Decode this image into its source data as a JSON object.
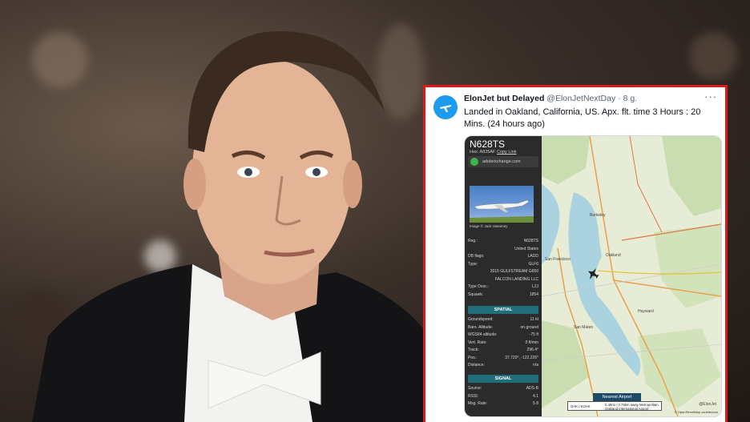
{
  "tweet": {
    "name": "ElonJet but Delayed",
    "handle": "@ElonJetNextDay",
    "dot": "·",
    "time": "8 g.",
    "more": "···",
    "text": "Landed in Oakland, California, US. Apx. flt. time 3 Hours : 20 Mins. (24 hours ago)"
  },
  "panel": {
    "registration": "N628TS",
    "hex_label": "Hex:",
    "hex_value": "A835AF",
    "copy_link": "Copy Link",
    "source_site": "adsbexchange.com",
    "photo_credit": "Image © Jack Sweeney",
    "details": [
      {
        "k": "Reg.:",
        "v": "N628TS"
      },
      {
        "k": "",
        "v": "United States"
      },
      {
        "k": "DB flags:",
        "v": "LADD"
      },
      {
        "k": "Type:",
        "v": "GLF6"
      },
      {
        "k": "",
        "v": "2015 GULFSTREAM G650"
      },
      {
        "k": "",
        "v": "FALCON LANDING LLC"
      },
      {
        "k": "Type Desc.:",
        "v": "L2J"
      },
      {
        "k": "Squawk:",
        "v": "1854"
      }
    ],
    "spatial_label": "SPATIAL",
    "spatial": [
      {
        "k": "Groundspeed:",
        "v": "11 kt"
      },
      {
        "k": "Baro. Altitude:",
        "v": "on ground"
      },
      {
        "k": "WGS84 altitude:",
        "v": "-75 ft"
      },
      {
        "k": "Vert. Rate:",
        "v": "0 ft/min"
      },
      {
        "k": "Track:",
        "v": "296.4°"
      },
      {
        "k": "Pos.:",
        "v": "37.720°, -122.226°"
      },
      {
        "k": "Distance:",
        "v": "n/a"
      }
    ],
    "signal_label": "SIGNAL",
    "signal": [
      {
        "k": "Source:",
        "v": "ADS-B"
      },
      {
        "k": "RSSI:",
        "v": "4.1"
      },
      {
        "k": "Msg. Rate:",
        "v": "5.8"
      }
    ]
  },
  "map": {
    "nearest_label": "Nearest Airport",
    "airport_code": "OAK / KOAK",
    "airport_name": "0.48mi / 0.75km away Metropolitan Oakland International Airport",
    "watermark": "@ElonJet",
    "attribution": "© OpenStreetMap contributors",
    "place_labels": [
      "San Francisco",
      "Oakland",
      "San Mateo",
      "Hayward",
      "Berkeley"
    ]
  },
  "colors": {
    "highlight_border": "#e01818",
    "twitter_blue": "#1d9bf0",
    "section_bar": "#1f6e7a"
  }
}
